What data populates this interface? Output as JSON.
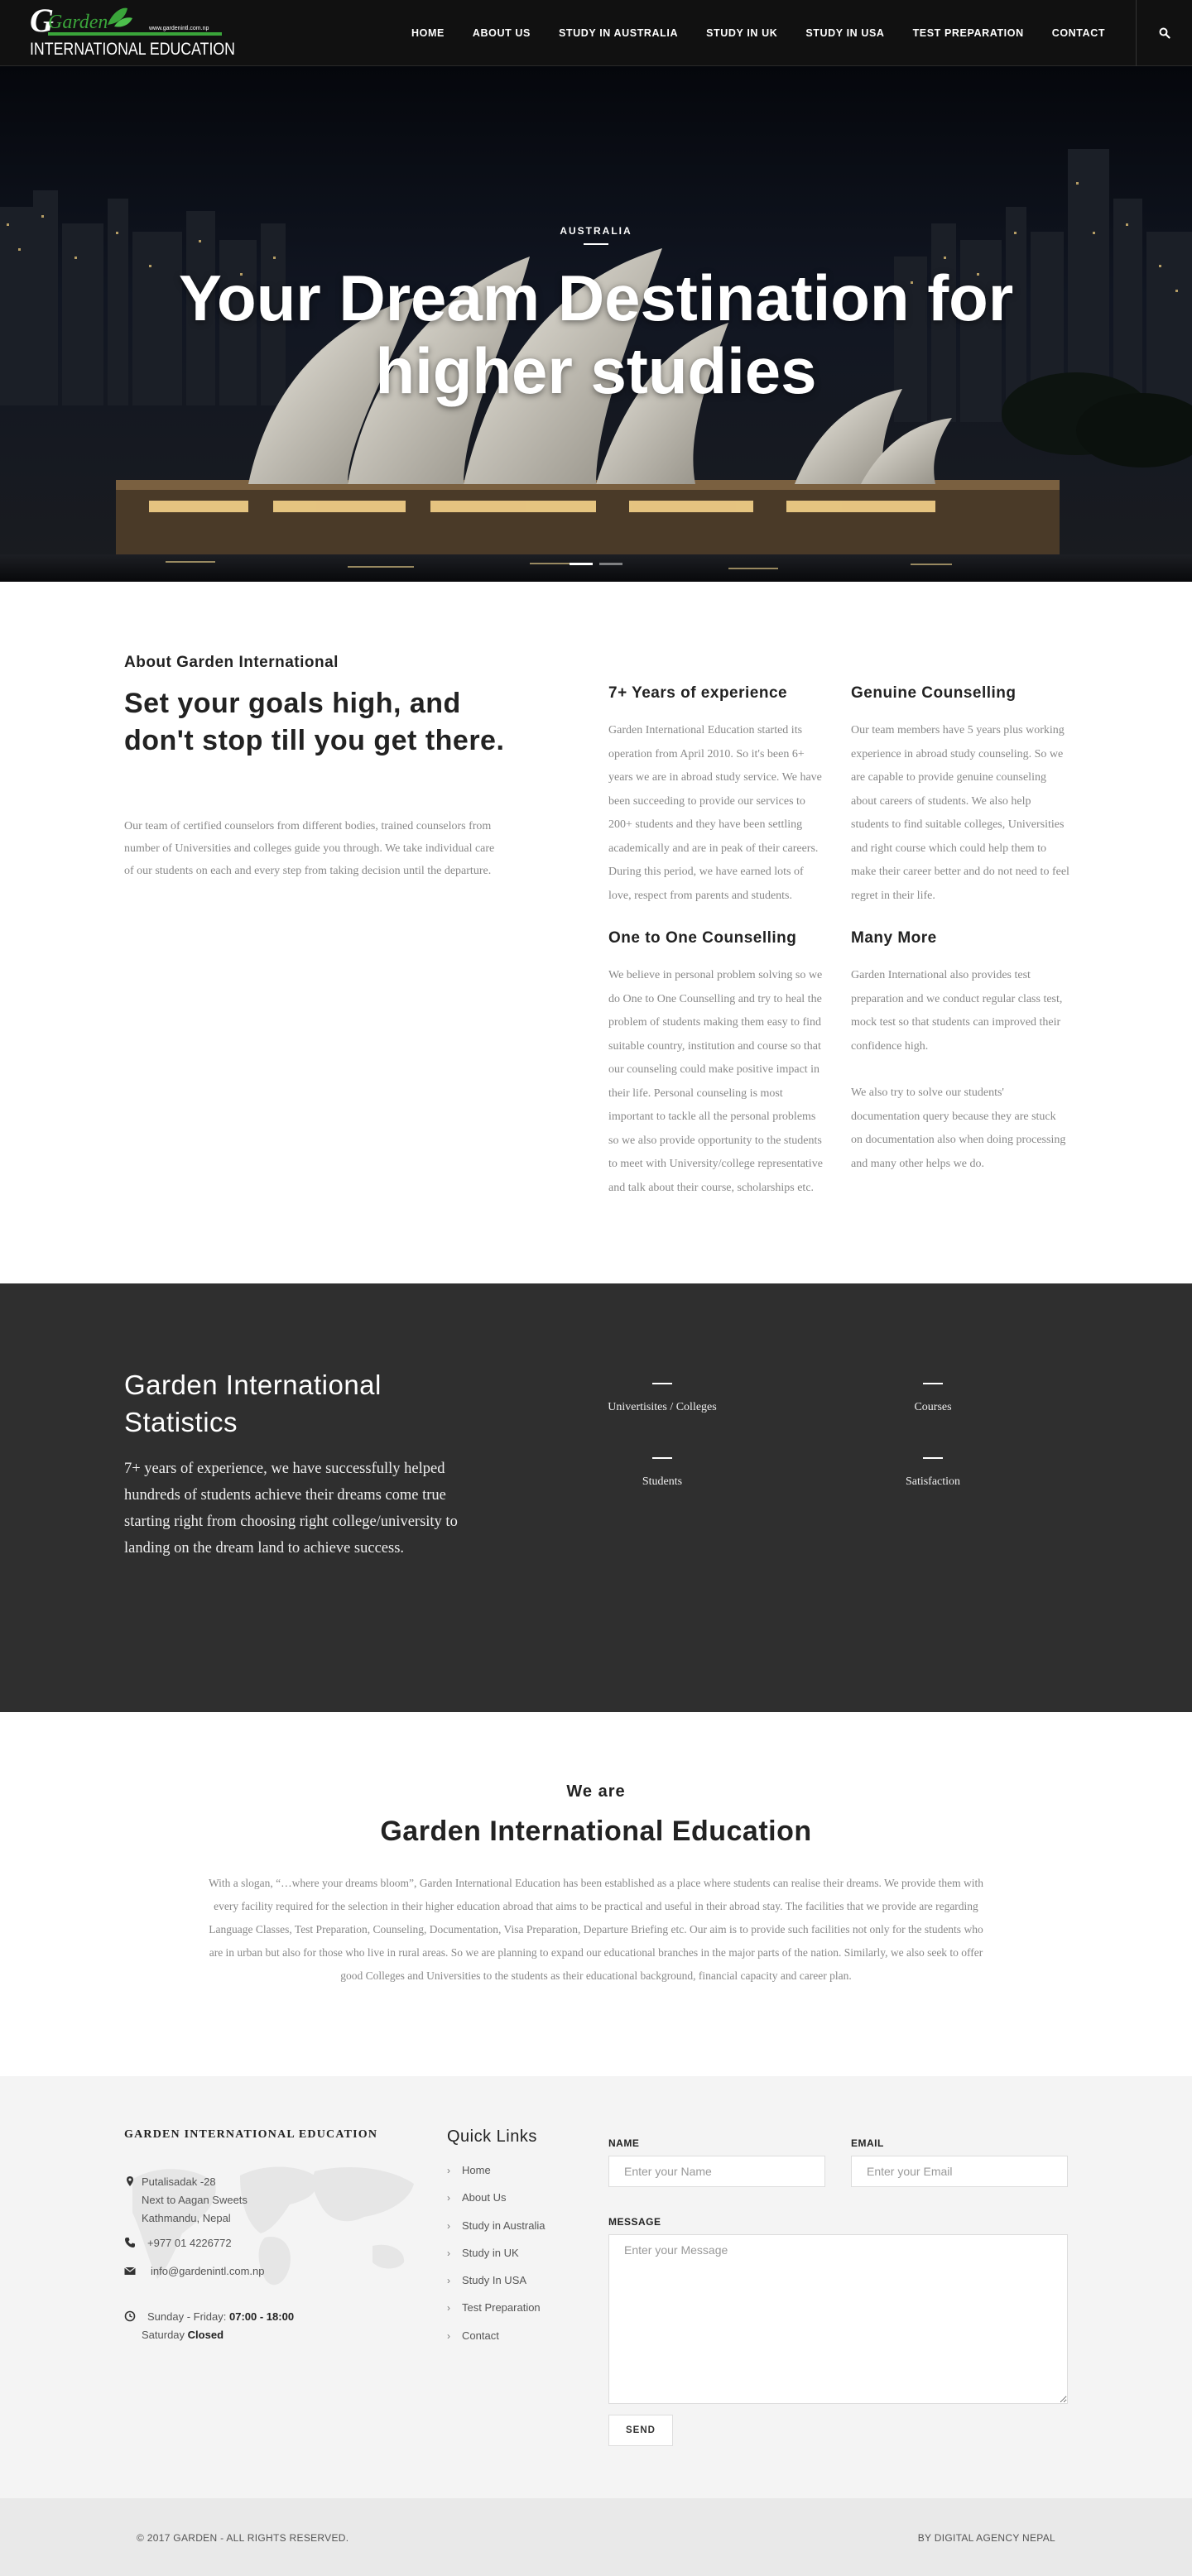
{
  "brand": {
    "logo_script": "Garden",
    "logo_main": "INTERNATIONAL EDUCATION",
    "logo_url": "www.gardenintl.com.np"
  },
  "nav": {
    "items": [
      "HOME",
      "ABOUT US",
      "STUDY IN AUSTRALIA",
      "STUDY IN UK",
      "STUDY IN USA",
      "TEST PREPARATION",
      "CONTACT"
    ],
    "search_icon": "search-icon"
  },
  "hero": {
    "subtitle": "AUSTRALIA",
    "title": "Your Dream Destination for higher studies",
    "slides": 2,
    "active_slide": 1
  },
  "about": {
    "eyebrow": "About Garden International",
    "heading": "Set your goals high, and don't stop till you get there.",
    "text": "Our team of certified counselors from different bodies, trained counselors from number of Universities and colleges guide you through. We take individual care of our students on each and every step from taking decision until the departure.",
    "features": [
      {
        "title": "7+ Years of experience",
        "text": "Garden International Education started its operation from April 2010. So it's been 6+ years we are in abroad study service. We have been succeeding to provide our services to 200+ students and they have been settling academically and are in peak of their careers. During this period, we have earned lots of love, respect from parents and students."
      },
      {
        "title": "Genuine Counselling",
        "text": "Our team members have 5 years plus working experience in abroad study counseling. So we are capable to provide genuine counseling about careers of students. We also help students to find suitable colleges, Universities and right course which could help them to make their career better and do not need to feel regret in their life."
      },
      {
        "title": "One to One Counselling",
        "text": "We believe in personal problem solving so we do One to One Counselling and try to heal the problem of students making them easy to find suitable country, institution and course so that our counseling could make positive impact in their life. Personal counseling is most important to tackle all the personal problems so we also provide opportunity to the students to meet with University/college representative and talk about their course, scholarships etc."
      },
      {
        "title": "Many More",
        "text": "Garden International also provides test preparation and we conduct regular class test, mock test so that students can improved their confidence high.",
        "text2": "We also try to solve our students' documentation query because they are stuck on documentation also when doing processing and many other helps we do."
      }
    ]
  },
  "stats": {
    "heading": "Garden International Statistics",
    "text": "7+ years of experience, we have successfully helped hundreds of students achieve their dreams come true starting right from choosing right college/university to landing on the dream land to achieve success.",
    "items": [
      "Univertisites / Colleges",
      "Courses",
      "Students",
      "Satisfaction"
    ]
  },
  "weare": {
    "small": "We are",
    "title": "Garden International Education",
    "text": "With a slogan, “…where your dreams bloom”, Garden International Education has been established as a place where students can realise their dreams. We provide them with every facility required for the selection in their higher education abroad that aims to be practical and useful in their abroad stay. The facilities that we provide are regarding Language Classes, Test Preparation, Counseling, Documentation, Visa Preparation, Departure Briefing etc. Our aim is to provide such facilities not only for the students who are in urban but also for those who live in rural areas. So we are planning to expand our educational branches in the major parts of the nation. Similarly, we also seek to offer good Colleges and Universities to the students as their educational background, financial capacity and career plan."
  },
  "footer": {
    "title": "GARDEN INTERNATIONAL EDUCATION",
    "address_lines": [
      "Putalisadak -28",
      "Next to Aagan Sweets",
      "Kathmandu, Nepal"
    ],
    "phone": "+977 01 4226772",
    "email": "info@gardenintl.com.np",
    "hours_weekday_label": "Sunday - Friday:",
    "hours_weekday": "07:00 - 18:00",
    "hours_saturday_label": "Saturday",
    "hours_saturday": "Closed",
    "quick_links_title": "Quick Links",
    "quick_links": [
      "Home",
      "About Us",
      "Study in Australia",
      "Study in UK",
      "Study In USA",
      "Test Preparation",
      "Contact"
    ],
    "form": {
      "name_label": "NAME",
      "name_placeholder": "Enter your Name",
      "email_label": "EMAIL",
      "email_placeholder": "Enter your Email",
      "message_label": "MESSAGE",
      "message_placeholder": "Enter your Message",
      "send_label": "SEND"
    }
  },
  "copyright": {
    "left": "© 2017 GARDEN - ALL RIGHTS RESERVED.",
    "right": "BY DIGITAL AGENCY NEPAL"
  },
  "colors": {
    "header_bg": "#111111",
    "stats_bg": "#2f2f2f",
    "footer_bg": "#f4f4f4",
    "copyright_bg": "#e9e9e9",
    "logo_green": "#3aa53a"
  }
}
